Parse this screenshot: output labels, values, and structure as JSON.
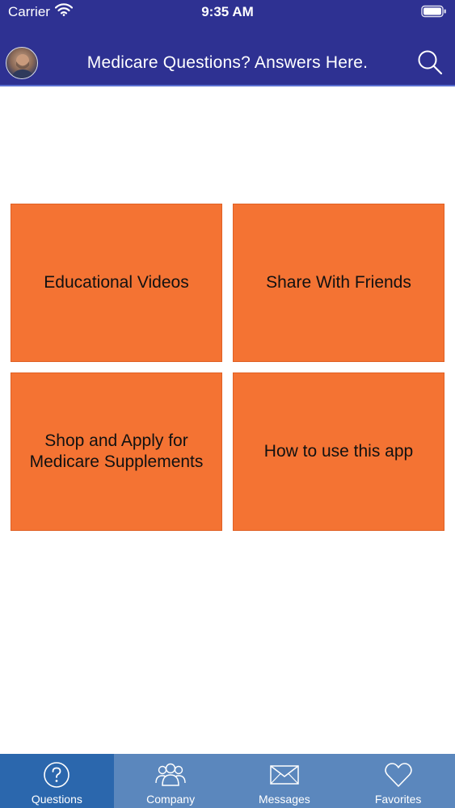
{
  "status_bar": {
    "carrier": "Carrier",
    "time": "9:35 AM"
  },
  "header": {
    "title": "Medicare Questions? Answers Here.",
    "search_icon": "search-icon",
    "avatar": "profile-photo"
  },
  "tiles": [
    {
      "label": "Educational Videos"
    },
    {
      "label": "Share With Friends"
    },
    {
      "label": "Shop and Apply for Medicare Supplements"
    },
    {
      "label": "How to use this app"
    }
  ],
  "tabbar": {
    "active": "Questions",
    "items": [
      {
        "label": "Questions",
        "icon": "question-icon"
      },
      {
        "label": "Company",
        "icon": "people-icon"
      },
      {
        "label": "Messages",
        "icon": "envelope-icon"
      },
      {
        "label": "Favorites",
        "icon": "heart-icon"
      }
    ]
  },
  "colors": {
    "header": "#2e3192",
    "tile": "#f47333",
    "tabbar": "#5b87bd",
    "tab_active": "#2b67ad"
  }
}
